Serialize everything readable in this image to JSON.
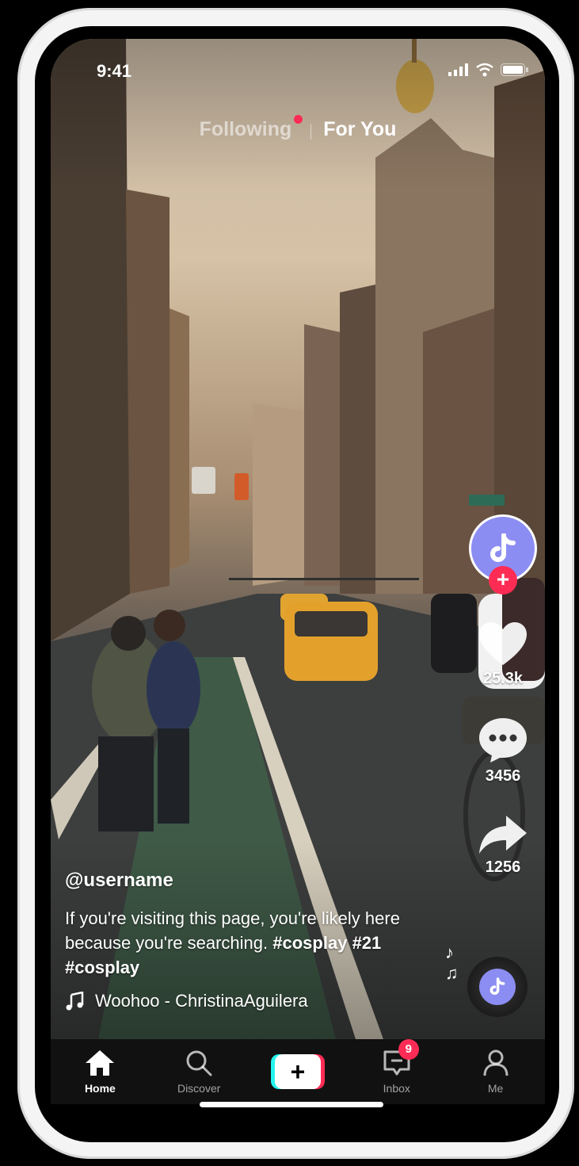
{
  "status_bar": {
    "time": "9:41"
  },
  "feed_tabs": {
    "following": "Following",
    "for_you": "For You"
  },
  "right_rail": {
    "likes": "25.3k",
    "comments": "3456",
    "shares": "1256"
  },
  "caption": {
    "username": "@username",
    "text": "If you're visiting this page, you're likely here because you're searching.",
    "tag1": "#cosplay",
    "tag2": "#21",
    "tag3": "#cosplay",
    "music": "Woohoo - ChristinaAguilera"
  },
  "tab_bar": {
    "home": "Home",
    "discover": "Discover",
    "inbox": "Inbox",
    "inbox_badge": "9",
    "me": "Me"
  },
  "colors": {
    "accent_red": "#fe2c55",
    "accent_cyan": "#25f4ee",
    "avatar_purple": "#8c8df2"
  }
}
